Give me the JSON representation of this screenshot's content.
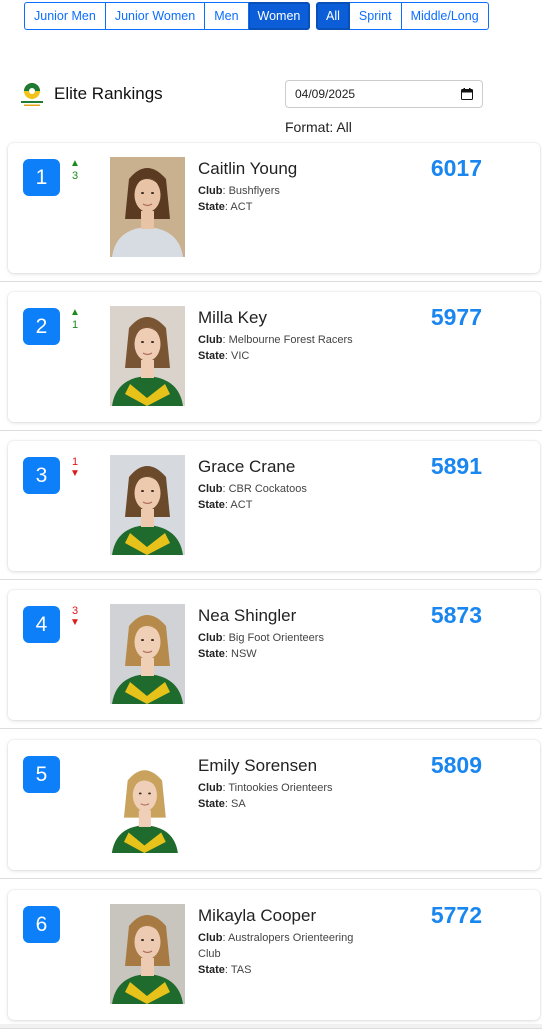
{
  "filters": {
    "categories": [
      {
        "label": "Junior Men",
        "active": false
      },
      {
        "label": "Junior Women",
        "active": false
      },
      {
        "label": "Men",
        "active": false
      },
      {
        "label": "Women",
        "active": true
      }
    ],
    "formats": [
      {
        "label": "All",
        "active": true
      },
      {
        "label": "Sprint",
        "active": false
      },
      {
        "label": "Middle/Long",
        "active": false
      }
    ]
  },
  "header": {
    "title": "Elite Rankings",
    "date_value": "04/09/2025",
    "format_label": "Format: All"
  },
  "labels": {
    "club": "Club",
    "state": "State"
  },
  "rankings": [
    {
      "rank": "1",
      "movement": "3",
      "direction": "up",
      "name": "Caitlin Young",
      "club": "Bushflyers",
      "state": "ACT",
      "points": "6017"
    },
    {
      "rank": "2",
      "movement": "1",
      "direction": "up",
      "name": "Milla Key",
      "club": "Melbourne Forest Racers",
      "state": "VIC",
      "points": "5977"
    },
    {
      "rank": "3",
      "movement": "1",
      "direction": "down",
      "name": "Grace Crane",
      "club": "CBR Cockatoos",
      "state": "ACT",
      "points": "5891"
    },
    {
      "rank": "4",
      "movement": "3",
      "direction": "down",
      "name": "Nea Shingler",
      "club": "Big Foot Orienteers",
      "state": "NSW",
      "points": "5873"
    },
    {
      "rank": "5",
      "movement": "",
      "direction": "none",
      "name": "Emily Sorensen",
      "club": "Tintookies Orienteers",
      "state": "SA",
      "points": "5809"
    },
    {
      "rank": "6",
      "movement": "",
      "direction": "none",
      "name": "Mikayla Cooper",
      "club": "Australopers Orienteering Club",
      "state": "TAS",
      "points": "5772"
    }
  ],
  "icons": {
    "logo": "orienteering-australia-logo",
    "calendar": "calendar-icon",
    "up": "triangle-up-icon",
    "down": "triangle-down-icon"
  },
  "colors": {
    "accent": "#0d7ff9",
    "points": "#1a86f0",
    "up": "#1a8a1a",
    "down": "#e01818",
    "jersey_green": "#1f6b2e",
    "jersey_gold": "#e7c21a"
  }
}
